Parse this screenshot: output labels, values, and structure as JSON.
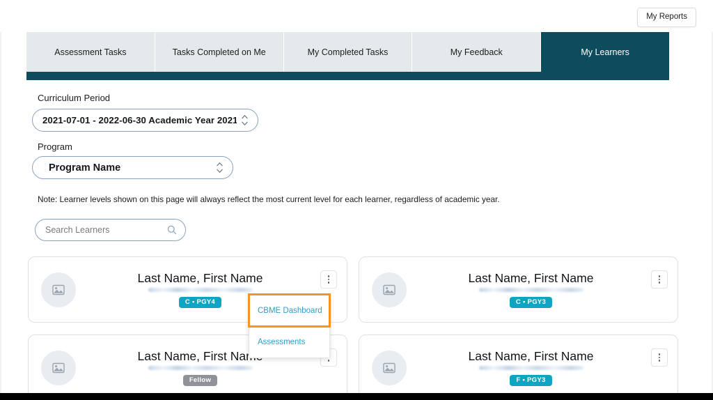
{
  "topbar": {
    "my_reports_label": "My Reports"
  },
  "tabs": [
    {
      "label": "Assessment Tasks",
      "active": false
    },
    {
      "label": "Tasks Completed on Me",
      "active": false
    },
    {
      "label": "My Completed Tasks",
      "active": false
    },
    {
      "label": "My Feedback",
      "active": false
    },
    {
      "label": "My Learners",
      "active": true
    }
  ],
  "filters": {
    "curriculum_label": "Curriculum Period",
    "curriculum_value": "2021-07-01 - 2022-06-30 Academic Year 2021",
    "program_label": "Program",
    "program_value": "Program Name"
  },
  "note": "Note: Learner levels shown on this page will always reflect the most current level for each learner, regardless of academic year.",
  "search": {
    "placeholder": "Search Learners",
    "value": ""
  },
  "learners": [
    {
      "name": "Last Name, First Name",
      "badge": "C • PGY4",
      "badge_style": "teal"
    },
    {
      "name": "Last Name, First Name",
      "badge": "C • PGY3",
      "badge_style": "teal"
    },
    {
      "name": "Last Name, First Name",
      "badge": "Fellow",
      "badge_style": "gray"
    },
    {
      "name": "Last Name, First Name",
      "badge": "F • PGY3",
      "badge_style": "teal"
    }
  ],
  "dropdown": {
    "items": [
      {
        "label": "CBME Dashboard",
        "highlighted": true
      },
      {
        "label": "Assessments",
        "highlighted": false
      }
    ]
  },
  "colors": {
    "active_tab": "#0d4c5c",
    "tab_bg": "#e4eaec",
    "badge_teal": "#0fa3c4",
    "badge_gray": "#8f9296",
    "highlight_orange": "#f59324",
    "link_blue": "#2f9ec4"
  }
}
